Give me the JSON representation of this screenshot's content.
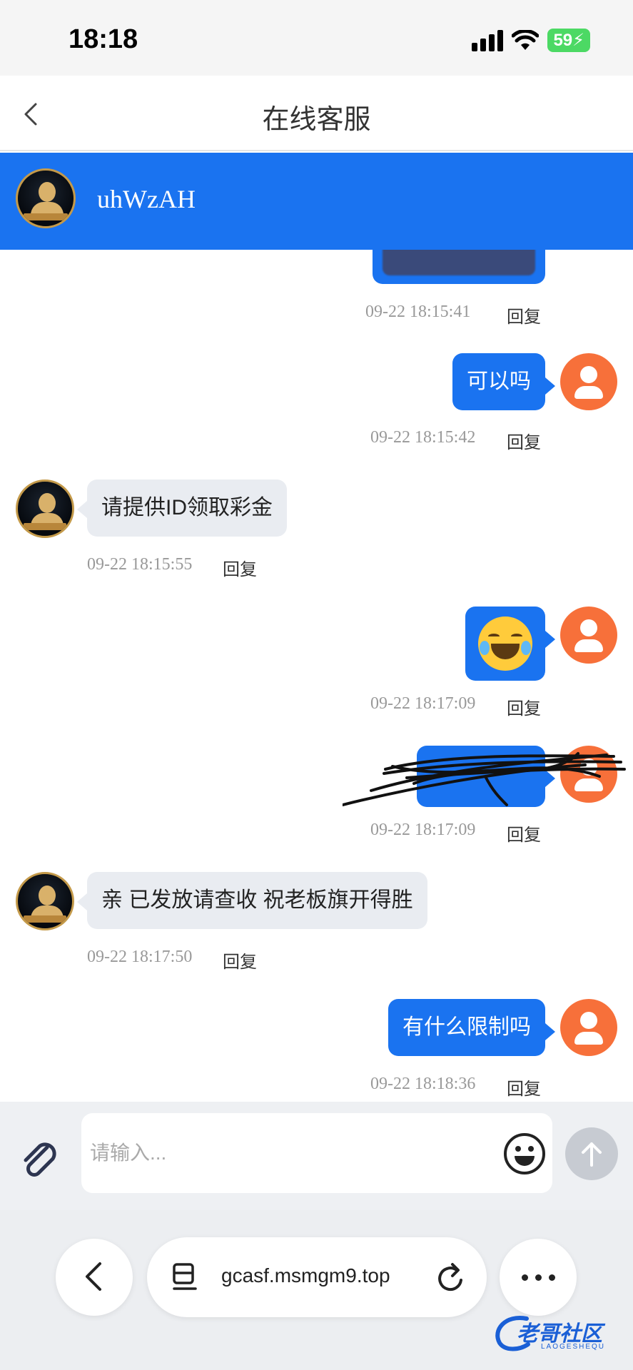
{
  "status_bar": {
    "time": "18:18",
    "battery": "59"
  },
  "header": {
    "title": "在线客服"
  },
  "agent": {
    "name": "uhWzAH"
  },
  "messages": [
    {
      "direction": "out",
      "kind": "image",
      "time": "09-22 18:15:41",
      "reply": "回复"
    },
    {
      "direction": "out",
      "kind": "text",
      "text": "可以吗",
      "time": "09-22 18:15:42",
      "reply": "回复"
    },
    {
      "direction": "in",
      "kind": "text",
      "text": "请提供ID领取彩金",
      "time": "09-22 18:15:55",
      "reply": "回复"
    },
    {
      "direction": "out",
      "kind": "emoji",
      "emoji": "face-with-tears-of-joy",
      "time": "09-22 18:17:09",
      "reply": "回复"
    },
    {
      "direction": "out",
      "kind": "redacted",
      "time": "09-22 18:17:09",
      "reply": "回复"
    },
    {
      "direction": "in",
      "kind": "text",
      "text": "亲 已发放请查收 祝老板旗开得胜",
      "time": "09-22 18:17:50",
      "reply": "回复"
    },
    {
      "direction": "out",
      "kind": "text",
      "text": "有什么限制吗",
      "time": "09-22 18:18:36",
      "reply": "回复"
    }
  ],
  "input": {
    "placeholder": "请输入..."
  },
  "browser": {
    "url": "gcasf.msmgm9.top"
  },
  "watermark": {
    "text": "老哥社区",
    "sub": "LAOGESHEQU"
  },
  "colors": {
    "accent": "#1a73f0",
    "user_avatar": "#f7703a",
    "incoming_bubble": "#e9ecf1"
  }
}
